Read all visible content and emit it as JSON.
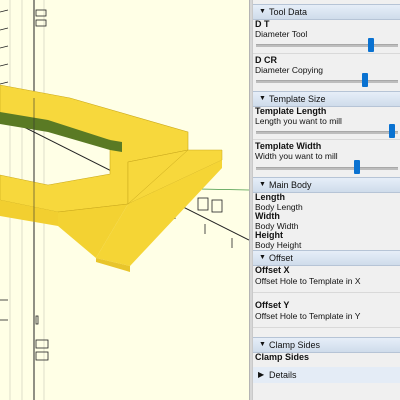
{
  "sections": [
    {
      "header": "Tool Data"
    },
    {
      "header": "Template Size"
    },
    {
      "header": "Main Body"
    },
    {
      "header": "Offset"
    },
    {
      "header": "Clamp Sides"
    }
  ],
  "params": {
    "dt": {
      "title": "D T",
      "desc": "Diameter Tool",
      "value_fraction": 0.82
    },
    "dcr": {
      "title": "D CR",
      "desc": "Diameter Copying",
      "value_fraction": 0.78
    },
    "template_length": {
      "title": "Template Length",
      "desc": "Length you want to mill",
      "value_fraction": 0.96
    },
    "template_width": {
      "title": "Template Width",
      "desc": "Width you want to mill",
      "value_fraction": 0.72
    },
    "length": {
      "title": "Length",
      "desc": "Body Length"
    },
    "width": {
      "title": "Width",
      "desc": "Body Width"
    },
    "height": {
      "title": "Height",
      "desc": "Body Height"
    },
    "offset_x": {
      "title": "Offset X",
      "desc": "Offset Hole to Template in X"
    },
    "offset_y": {
      "title": "Offset Y",
      "desc": "Offset Hole to Template in Y"
    },
    "clamp_sides": {
      "title": "Clamp Sides"
    }
  },
  "details": {
    "label": "Details",
    "icon": "triangle-right-icon"
  },
  "colors": {
    "model_face": "#f7d83c",
    "model_shade": "#e8c52b",
    "model_dark": "#5a7a24",
    "viewport_bg": "#ffffe6",
    "slider_thumb": "#0a72d1"
  }
}
